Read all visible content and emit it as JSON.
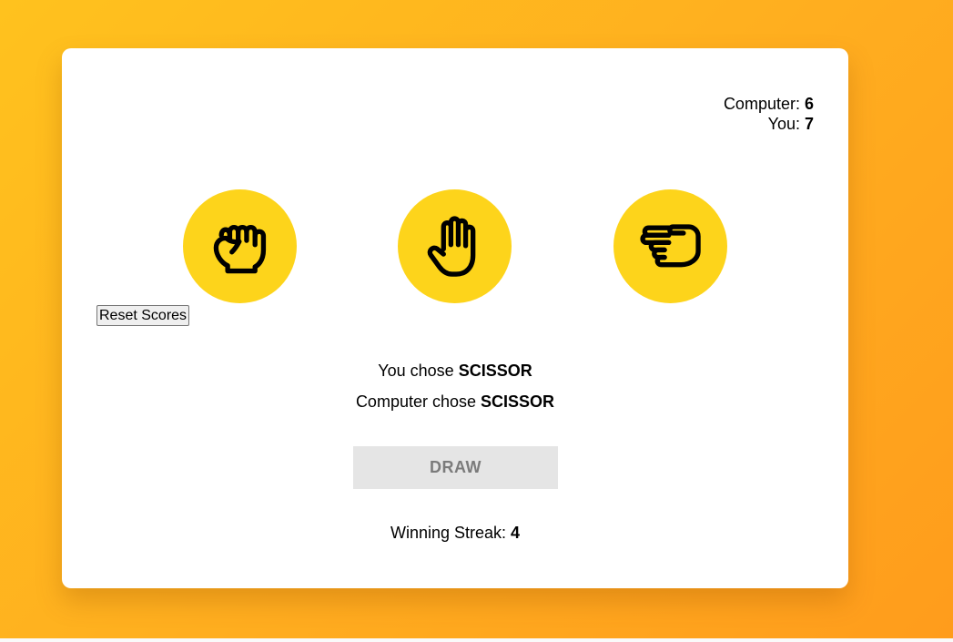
{
  "scoreboard": {
    "computer_label": "Computer: ",
    "computer_score": "6",
    "you_label": "You: ",
    "you_score": "7"
  },
  "choices": [
    {
      "name": "rock",
      "icon": "fist-icon"
    },
    {
      "name": "paper",
      "icon": "open-hand-icon"
    },
    {
      "name": "scissor",
      "icon": "scissor-hand-icon"
    }
  ],
  "reset_label": "Reset Scores",
  "result": {
    "you_prefix": "You chose ",
    "you_choice": "SCISSOR",
    "computer_prefix": "Computer chose ",
    "computer_choice": "SCISSOR",
    "outcome": "DRAW"
  },
  "streak": {
    "label": "Winning Streak: ",
    "value": "4"
  },
  "colors": {
    "background_start": "#ffc21e",
    "background_end": "#ff9c1c",
    "choice_circle": "#fdd41b",
    "result_box": "#e5e5e5",
    "result_text": "#7b7b7b"
  }
}
